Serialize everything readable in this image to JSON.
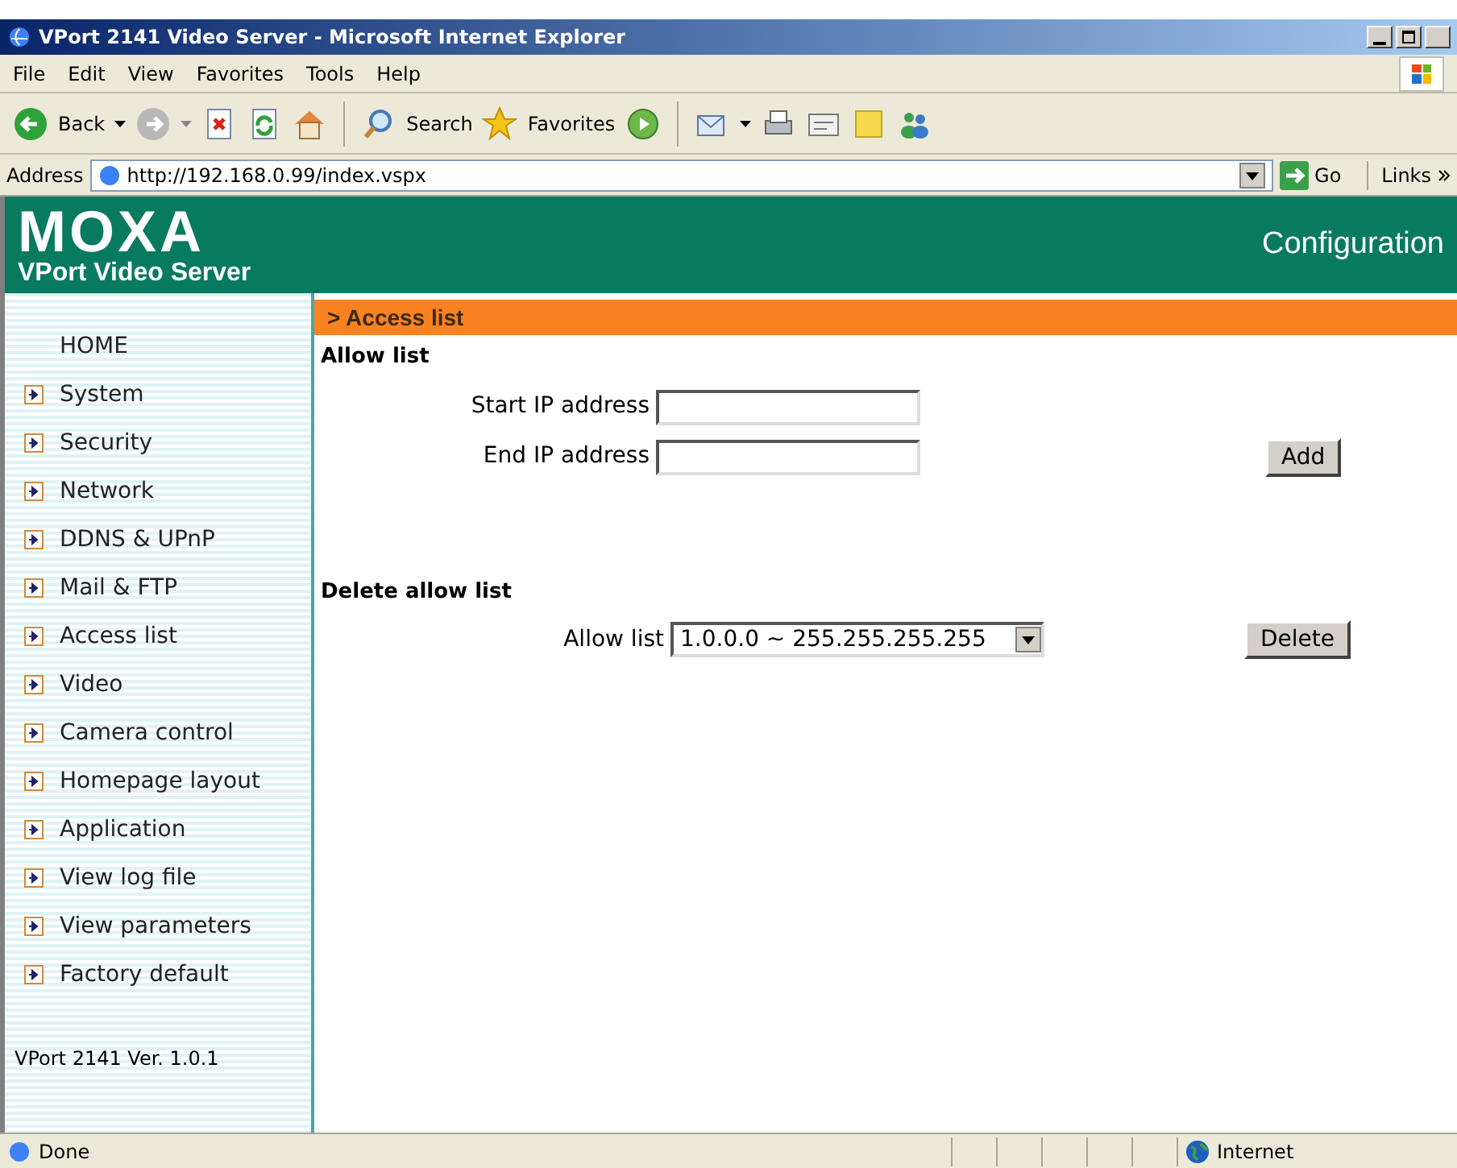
{
  "window": {
    "title": "VPort 2141 Video Server - Microsoft Internet Explorer"
  },
  "menu_bar": [
    "File",
    "Edit",
    "View",
    "Favorites",
    "Tools",
    "Help"
  ],
  "toolbar": {
    "back": "Back",
    "search": "Search",
    "favorites": "Favorites"
  },
  "address_bar": {
    "label": "Address",
    "url": "http://192.168.0.99/index.vspx",
    "go": "Go",
    "links": "Links"
  },
  "header": {
    "logo": "MOXA",
    "subtitle": "VPort Video Server",
    "title": "Configuration"
  },
  "breadcrumb": "> Access list",
  "sidebar": {
    "items": [
      {
        "label": "HOME",
        "kind": "home"
      },
      {
        "label": "System",
        "kind": "link"
      },
      {
        "label": "Security",
        "kind": "link"
      },
      {
        "label": "Network",
        "kind": "link"
      },
      {
        "label": "DDNS & UPnP",
        "kind": "link"
      },
      {
        "label": "Mail & FTP",
        "kind": "link"
      },
      {
        "label": "Access list",
        "kind": "link"
      },
      {
        "label": "Video",
        "kind": "link"
      },
      {
        "label": "Camera control",
        "kind": "link"
      },
      {
        "label": "Homepage layout",
        "kind": "link"
      },
      {
        "label": "Application",
        "kind": "link"
      },
      {
        "label": "View log file",
        "kind": "link"
      },
      {
        "label": "View parameters",
        "kind": "link"
      },
      {
        "label": "Factory default",
        "kind": "link"
      }
    ],
    "version": "VPort 2141 Ver. 1.0.1"
  },
  "allow_list": {
    "heading": "Allow list",
    "start_label": "Start IP address",
    "end_label": "End IP address",
    "add": "Add"
  },
  "delete_allow_list": {
    "heading": "Delete allow list",
    "label": "Allow list",
    "value": "1.0.0.0 ~ 255.255.255.255",
    "delete": "Delete"
  },
  "status_bar": {
    "text": "Done",
    "zone": "Internet"
  }
}
